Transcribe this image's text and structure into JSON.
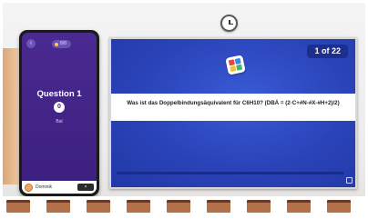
{
  "phone": {
    "back_icon": "chevron-left-icon",
    "pill_label": "8/8",
    "question_label": "Question 1",
    "score": "0",
    "score_label": "Bal",
    "player_name": "Dominik",
    "footer_button": "×"
  },
  "screen": {
    "counter": "1 of 22",
    "question": "Was ist das Doppelbindungsäquivalent für C6H10? (DBÄ = (2·C+#N-#X-#H+2)/2)",
    "logo_icon": "quiz-logo-icon",
    "fullscreen_icon": "fullscreen-icon"
  },
  "colors": {
    "screen_blue": "#2a43b8",
    "phone_purple": "#4a2a91",
    "counter_bg": "#1c2f8e"
  }
}
